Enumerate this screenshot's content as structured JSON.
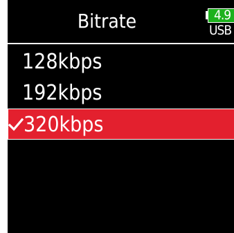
{
  "header": {
    "title": "Bitrate",
    "battery_voltage": "4.9",
    "power_source": "USB",
    "battery_color": "#1db11d"
  },
  "list": {
    "items": [
      {
        "label": "128kbps",
        "selected": false
      },
      {
        "label": "192kbps",
        "selected": false
      },
      {
        "label": "320kbps",
        "selected": true
      }
    ],
    "selected_color": "#e3202e"
  },
  "icons": {
    "selected_marker": "check-icon",
    "battery": "battery-icon"
  }
}
